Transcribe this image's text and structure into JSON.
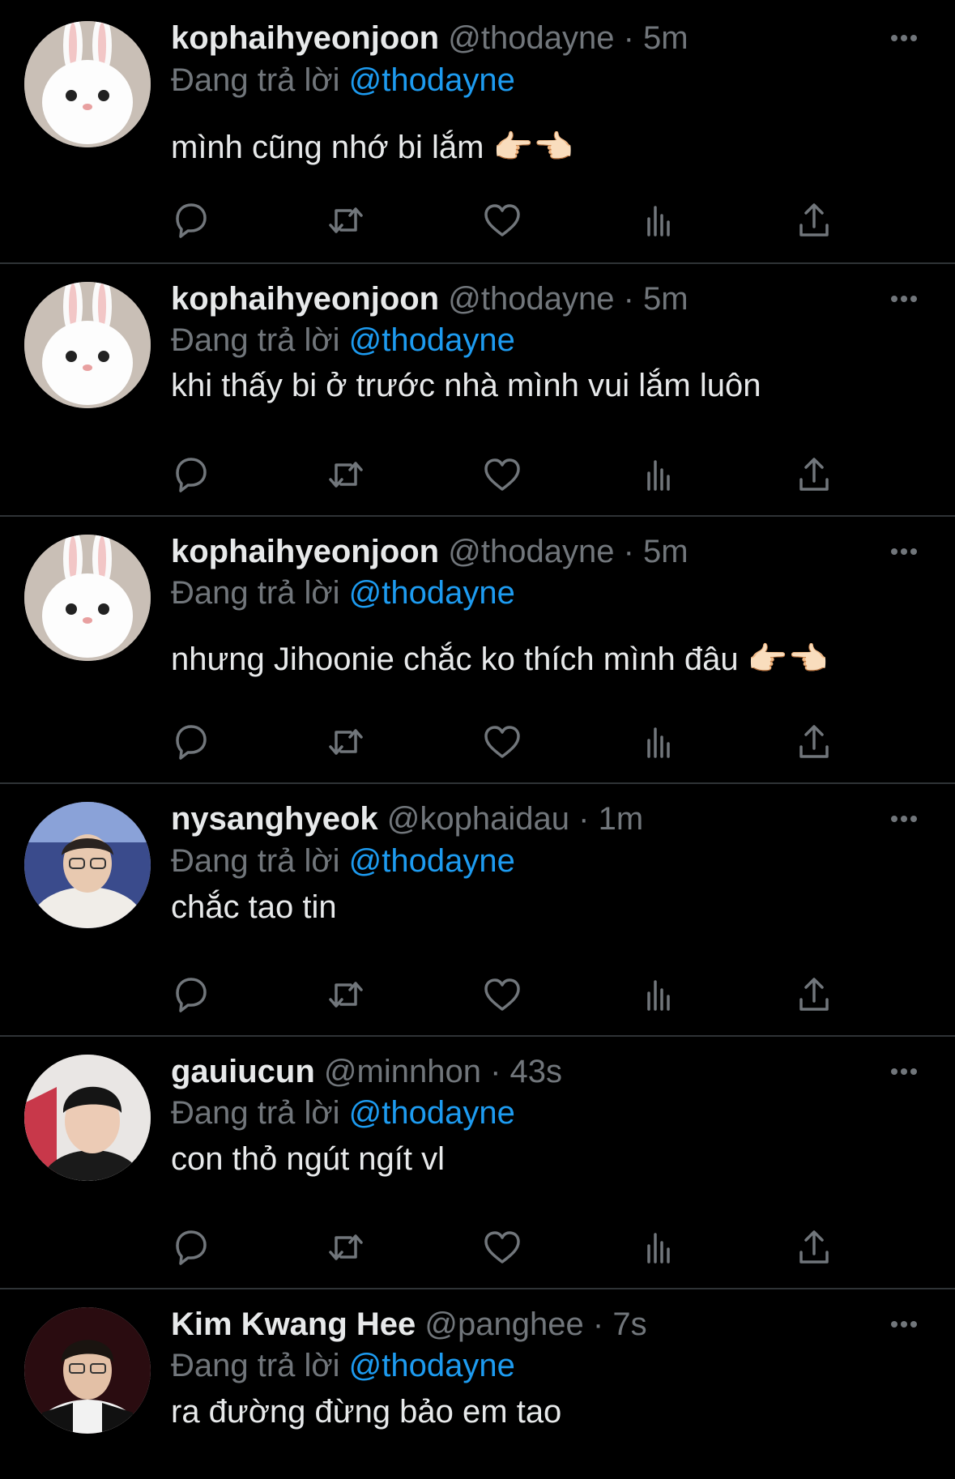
{
  "colors": {
    "background": "#000000",
    "primary_text": "#e7e9ea",
    "secondary_text": "#71767b",
    "accent": "#1d9bf0",
    "divider": "#2f3336"
  },
  "icons": {
    "reply": "reply-icon",
    "retweet": "retweet-icon",
    "like": "heart-icon",
    "views": "views-icon",
    "share": "share-icon",
    "more": "more-icon"
  },
  "tweets": [
    {
      "name": "kophaihyeonjoon",
      "handle": "@thodayne",
      "dot": "·",
      "time": "5m",
      "reply_prefix": "Đang trả lời",
      "reply_to": "@thodayne",
      "text": "mình cũng nhớ bi lắm 👉🏻👈🏻",
      "avatar": "bunny"
    },
    {
      "name": "kophaihyeonjoon",
      "handle": "@thodayne",
      "dot": "·",
      "time": "5m",
      "reply_prefix": "Đang trả lời",
      "reply_to": "@thodayne",
      "text": "khi thấy bi ở trước nhà mình vui lắm luôn",
      "avatar": "bunny"
    },
    {
      "name": "kophaihyeonjoon",
      "handle": "@thodayne",
      "dot": "·",
      "time": "5m",
      "reply_prefix": "Đang trả lời",
      "reply_to": "@thodayne",
      "text": "nhưng Jihoonie chắc ko thích mình đâu 👉🏻👈🏻",
      "avatar": "bunny"
    },
    {
      "name": "nysanghyeok",
      "handle": "@kophaidau",
      "dot": "·",
      "time": "1m",
      "reply_prefix": "Đang trả lời",
      "reply_to": "@thodayne",
      "text": "chắc tao tin",
      "avatar": "person-glasses"
    },
    {
      "name": "gauiucun",
      "handle": "@minnhon",
      "dot": "·",
      "time": "43s",
      "reply_prefix": "Đang trả lời",
      "reply_to": "@thodayne",
      "text": "con thỏ ngút ngít vl",
      "avatar": "person"
    },
    {
      "name": "Kim Kwang Hee",
      "handle": "@panghee",
      "dot": "·",
      "time": "7s",
      "reply_prefix": "Đang trả lời",
      "reply_to": "@thodayne",
      "text": "ra đường đừng bảo em tao",
      "avatar": "person-jersey"
    }
  ]
}
